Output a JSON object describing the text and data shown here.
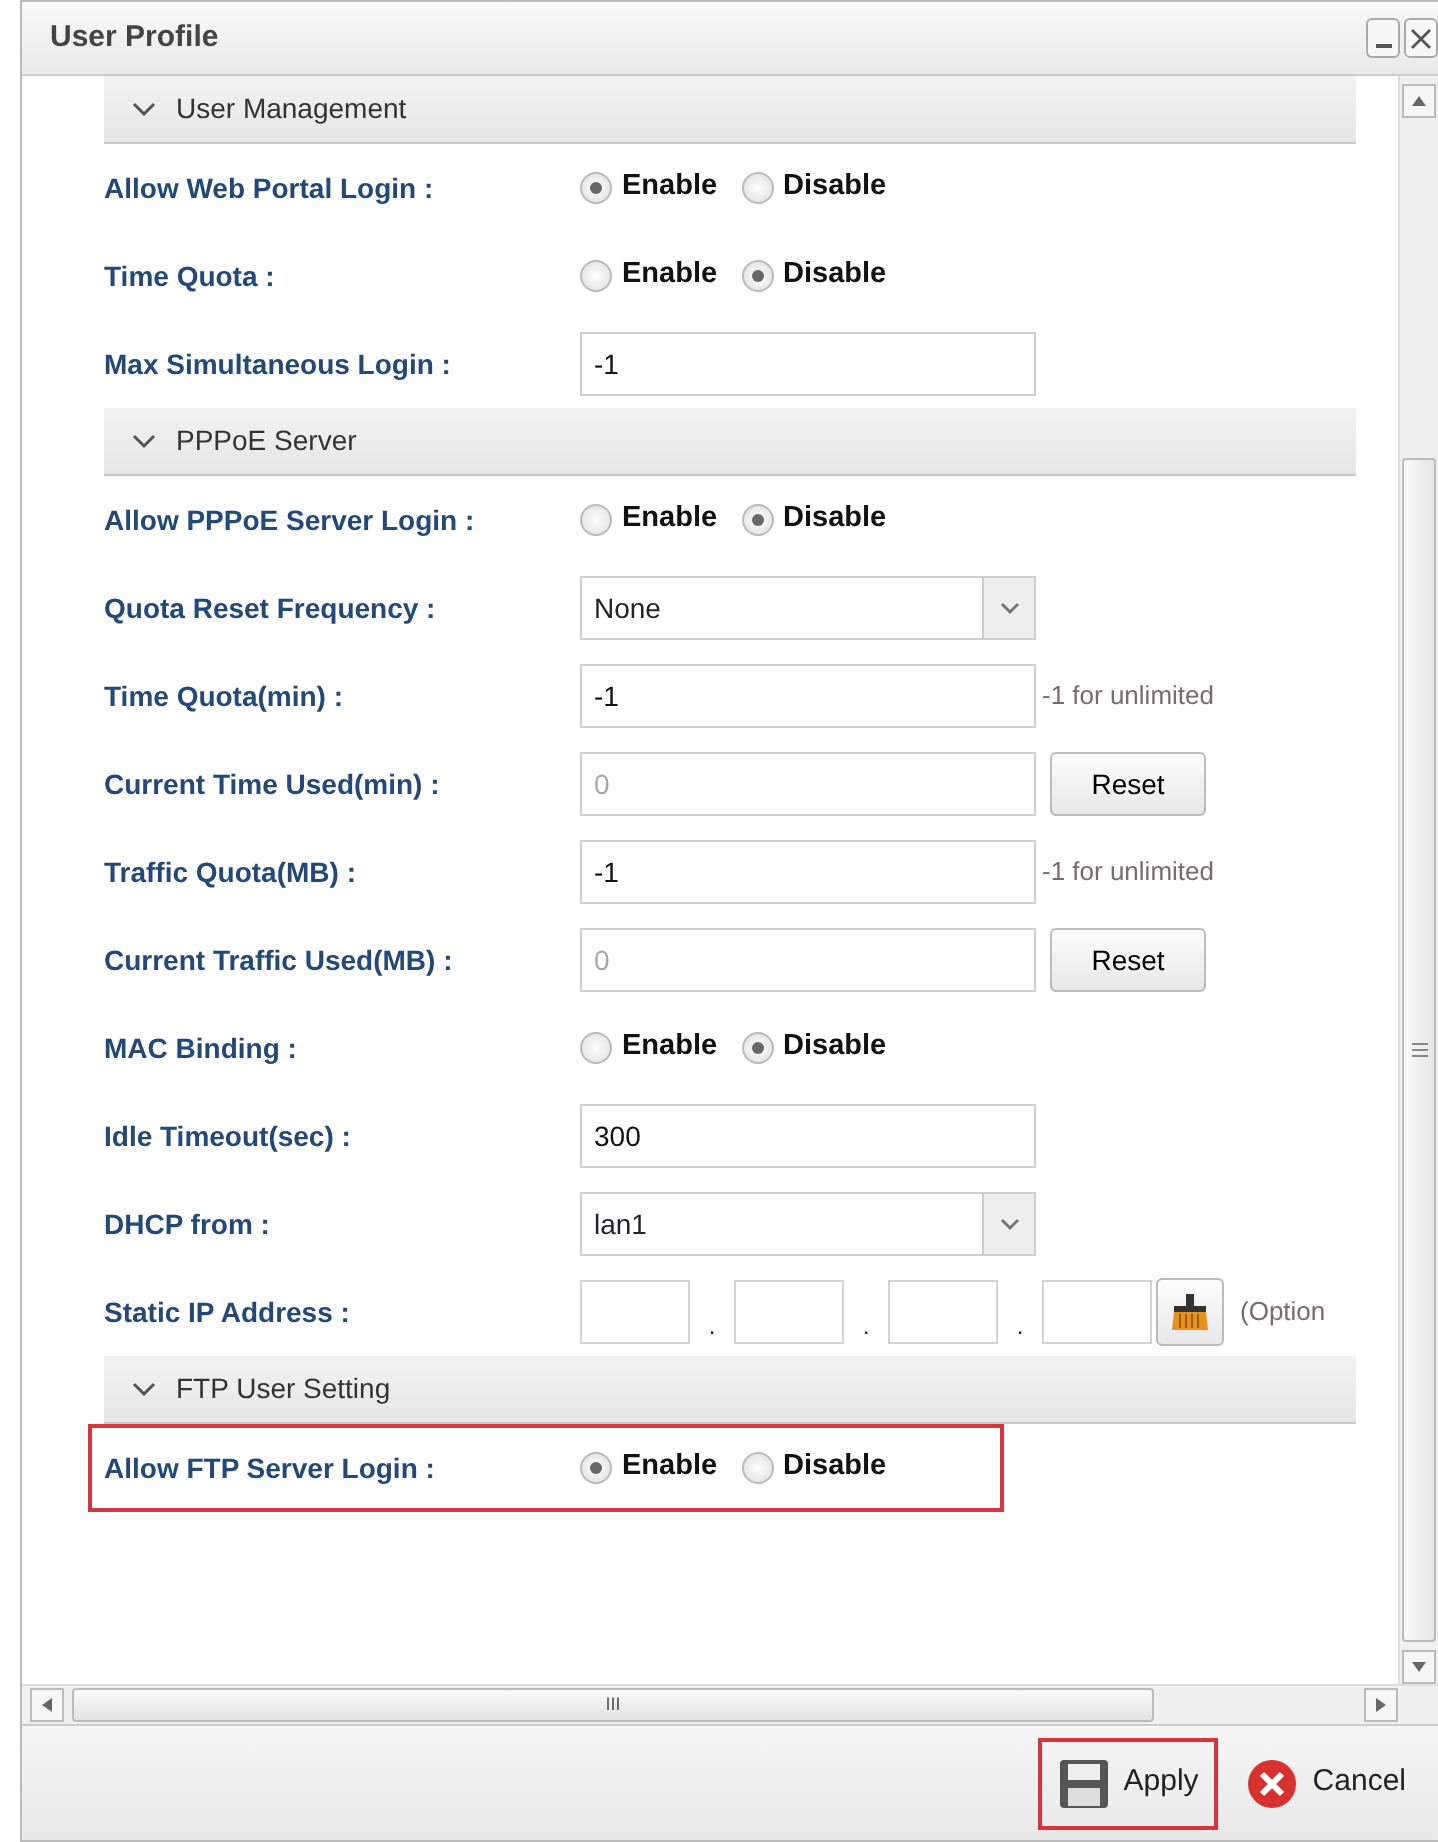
{
  "window": {
    "title": "User Profile"
  },
  "sections": [
    {
      "title": "User Management",
      "expanded": true,
      "rows": [
        {
          "kind": "radio",
          "label": "Allow Web Portal Login :",
          "highlighted": false,
          "options": [
            {
              "label": "Enable",
              "selected": true
            },
            {
              "label": "Disable",
              "selected": false
            }
          ]
        },
        {
          "kind": "radio",
          "label": "Time Quota :",
          "highlighted": false,
          "options": [
            {
              "label": "Enable",
              "selected": false
            },
            {
              "label": "Disable",
              "selected": true
            }
          ]
        },
        {
          "kind": "text",
          "label": "Max Simultaneous Login :",
          "value": "-1"
        }
      ]
    },
    {
      "title": "PPPoE Server",
      "expanded": true,
      "rows": [
        {
          "kind": "radio",
          "label": "Allow PPPoE Server Login :",
          "highlighted": false,
          "options": [
            {
              "label": "Enable",
              "selected": false
            },
            {
              "label": "Disable",
              "selected": true
            }
          ]
        },
        {
          "kind": "select",
          "label": "Quota Reset Frequency :",
          "value": "None"
        },
        {
          "kind": "text",
          "label": "Time Quota(min) :",
          "value": "-1",
          "hint": "-1 for unlimited"
        },
        {
          "kind": "text",
          "label": "Current Time Used(min) :",
          "value": "0",
          "disabled": true,
          "button": "Reset"
        },
        {
          "kind": "text",
          "label": "Traffic Quota(MB) :",
          "value": "-1",
          "hint": "-1 for unlimited"
        },
        {
          "kind": "text",
          "label": "Current Traffic Used(MB) :",
          "value": "0",
          "disabled": true,
          "button": "Reset"
        },
        {
          "kind": "radio",
          "label": "MAC Binding :",
          "highlighted": false,
          "options": [
            {
              "label": "Enable",
              "selected": false
            },
            {
              "label": "Disable",
              "selected": true
            }
          ]
        },
        {
          "kind": "text",
          "label": "Idle Timeout(sec) :",
          "value": "300"
        },
        {
          "kind": "select",
          "label": "DHCP from :",
          "value": "lan1"
        },
        {
          "kind": "ip",
          "label": "Static IP Address :",
          "separators": [
            ".",
            ".",
            "."
          ],
          "hint": "(Option"
        }
      ]
    },
    {
      "title": "FTP User Setting",
      "expanded": true,
      "rows": [
        {
          "kind": "radio",
          "label": "Allow FTP Server Login :",
          "highlighted": true,
          "options": [
            {
              "label": "Enable",
              "selected": true
            },
            {
              "label": "Disable",
              "selected": false
            }
          ]
        }
      ]
    }
  ],
  "scroll_grip": "III",
  "buttons": [
    {
      "kind": "save",
      "label": "Apply",
      "highlighted": true
    },
    {
      "kind": "cancel",
      "label": "Cancel",
      "highlighted": false
    }
  ]
}
